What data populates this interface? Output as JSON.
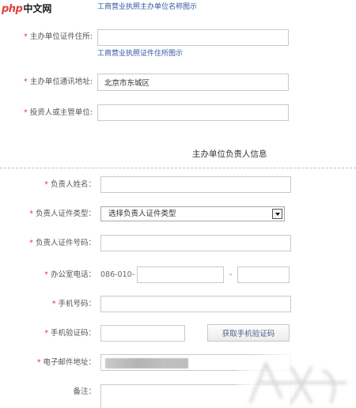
{
  "logo": {
    "mark": "php",
    "name": "中文网"
  },
  "required_mark": "*",
  "organizer": {
    "name_example_link": "工商营业执照主办单位名称图示",
    "address_label": "主办单位证件住所:",
    "address_example_link": "工商营业执照证件住所图示",
    "mailing_address_label": "主办单位通讯地址:",
    "mailing_address_value": "北京市东城区",
    "investor_label": "投资人或主管单位:"
  },
  "responsible_person": {
    "section_title": "主办单位负责人信息",
    "name_label": "负责人姓名：",
    "id_type_label": "负责人证件类型：",
    "id_type_selected": "选择负责人证件类型",
    "id_number_label": "负责人证件号码：",
    "office_phone_label": "办公室电话：",
    "office_phone_prefix": "086-010-",
    "office_phone_separator": "-",
    "mobile_label": "手机号码：",
    "sms_code_label": "手机验证码：",
    "sms_code_button": "获取手机验证码",
    "email_label": "电子邮件地址：",
    "remarks_label": "备注："
  },
  "icons": {
    "select_arrow": "chevron-down-icon"
  },
  "colors": {
    "required": "#e4393c",
    "link": "#34589e",
    "label": "#555555",
    "border": "#c9c9c9"
  }
}
